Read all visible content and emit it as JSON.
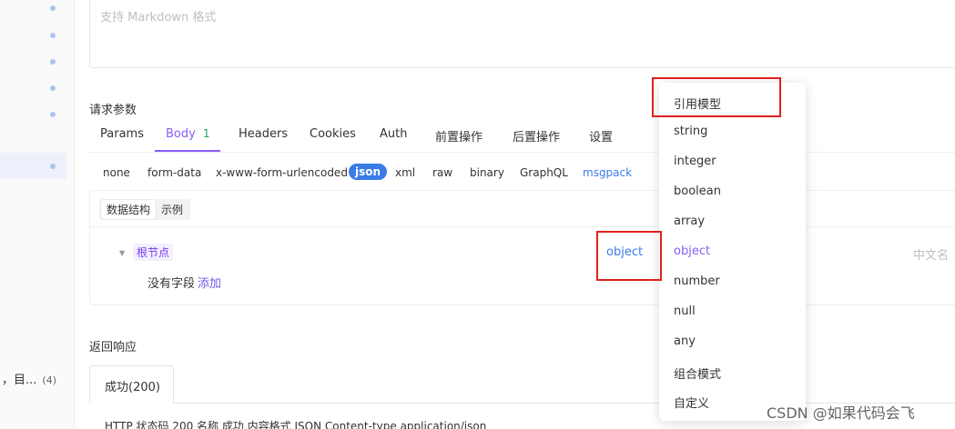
{
  "description": {
    "placeholder": "支持 Markdown 格式"
  },
  "request_params": {
    "label": "请求参数",
    "tabs": [
      {
        "label": "Params"
      },
      {
        "label": "Body",
        "badge": "1"
      },
      {
        "label": "Headers"
      },
      {
        "label": "Cookies"
      },
      {
        "label": "Auth"
      },
      {
        "label": "前置操作"
      },
      {
        "label": "后置操作"
      },
      {
        "label": "设置"
      }
    ],
    "body_types": [
      "none",
      "form-data",
      "x-www-form-urlencoded",
      "json",
      "xml",
      "raw",
      "binary",
      "GraphQL",
      "msgpack"
    ]
  },
  "schema": {
    "view_modes": [
      "数据结构",
      "示例"
    ],
    "root_label": "根节点",
    "root_type": "object",
    "empty_text": "没有字段",
    "add_link": "添加",
    "cn_name_placeholder": "中文名"
  },
  "response": {
    "label": "返回响应",
    "tab": "成功(200)",
    "bottom_row_text": "HTTP 状态码 200 名称 成功 内容格式 JSON Content-type application/json"
  },
  "sidebar": {
    "bottom_item": "，目...",
    "bottom_count": "(4)"
  },
  "type_dropdown": {
    "items": [
      "引用模型",
      "string",
      "integer",
      "boolean",
      "array",
      "object",
      "number",
      "null",
      "any",
      "组合模式",
      "自定义"
    ],
    "selected": "object"
  },
  "watermark": "CSDN @如果代码会飞",
  "colors": {
    "accent": "#8b5cf6",
    "link": "#3a7be8",
    "highlight": "#e0201e"
  }
}
